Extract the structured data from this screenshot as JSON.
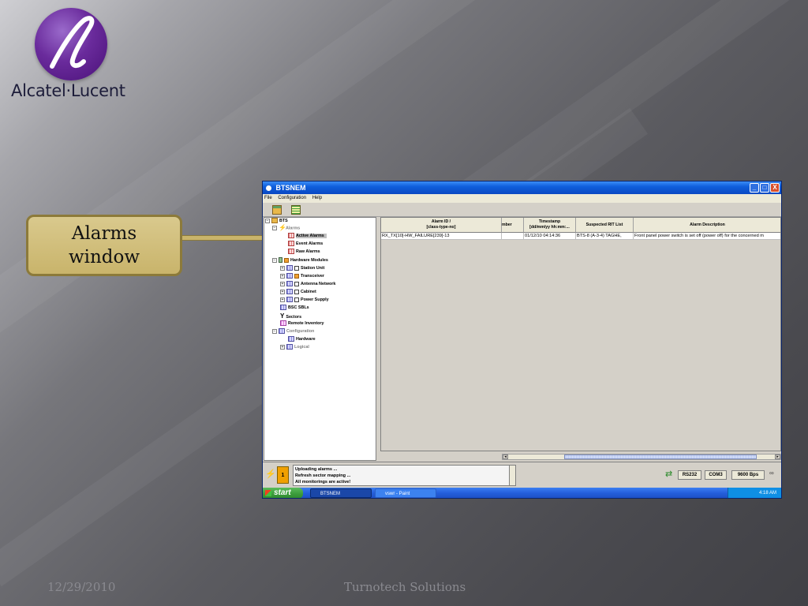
{
  "logo": {
    "brand_name": "Alcatel·Lucent"
  },
  "callout": {
    "line1": "Alarms",
    "line2": "window"
  },
  "window": {
    "title": "BTSNEM",
    "controls": {
      "minimize": "_",
      "maximize": "□",
      "close": "X"
    },
    "menu": [
      "File",
      "Configuration",
      "Help"
    ],
    "tree": {
      "root": "BTS",
      "alarms": "Alarms",
      "active_alarms": "Active Alarms",
      "event_alarms": "Event Alarms",
      "raw_alarms": "Raw Alarms",
      "hardware_modules": "Hardware Modules",
      "station_unit": "Station Unit",
      "transceiver": "Transceiver",
      "antenna_network": "Antenna Network",
      "cabinet": "Cabinet",
      "power_supply": "Power Supply",
      "bsc_sbls": "BSC SBLs",
      "sectors": "Sectors",
      "remote_inventory": "Remote Inventory",
      "configuration": "Configuration",
      "hardware": "Hardware",
      "logical": "Logical"
    },
    "table": {
      "columns": [
        {
          "line1": "Alarm ID  /",
          "line2": "[class-type-no]"
        },
        {
          "line1": "mber",
          "line2": ""
        },
        {
          "line1": "Timestamp",
          "line2": "[dd/mm/yy hh:mm:..."
        },
        {
          "line1": "Suspected RIT List",
          "line2": ""
        },
        {
          "line1": "Alarm Description",
          "line2": ""
        }
      ],
      "rows": [
        [
          "RX_TX[10]-HW_FAILURE[239]-13",
          "",
          "01/12/10 04:14:36",
          "BTS-8 (A-3-4) TAGHE,",
          "Front panel power switch is set off (power off) for the concerned m"
        ]
      ]
    },
    "status": {
      "badge_count": "1",
      "messages": [
        "Uploading alarms ...",
        "Refresh sector mapping ...",
        "All monitorings are active!"
      ],
      "port_type": "RS232",
      "com_port": "COM3",
      "baud_rate": "9600 Bps"
    },
    "taskbar": {
      "start_label": "start",
      "tasks": [
        "BTSNEM",
        "vswr - Paint"
      ],
      "clock": "4:18 AM"
    }
  },
  "footer": {
    "date": "12/29/2010",
    "company": "Turnotech Solutions"
  }
}
